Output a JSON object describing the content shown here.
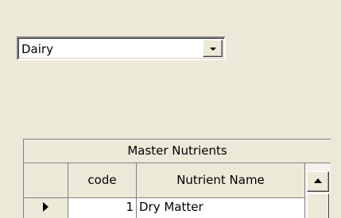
{
  "dropdown": {
    "selected": "Dairy"
  },
  "grid": {
    "caption": "Master Nutrients",
    "columns": [
      "",
      "code",
      "Nutrient Name"
    ],
    "rows": [
      {
        "code": "1",
        "name": "Dry Matter"
      }
    ]
  },
  "icons": {
    "dropdown_arrow": "chevron-down-icon",
    "row_pointer": "current-row-pointer-icon",
    "scroll_up": "scroll-up-arrow-icon"
  }
}
